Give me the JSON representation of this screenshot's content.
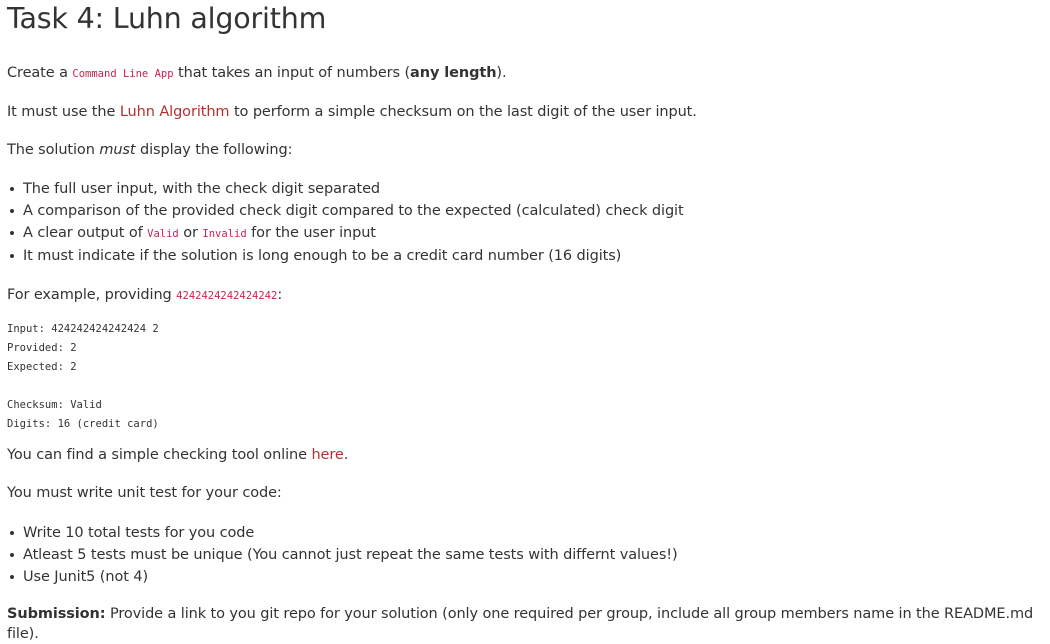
{
  "title": "Task 4: Luhn algorithm",
  "intro": {
    "prefix": "Create a ",
    "code": "Command Line App",
    "middle": " that takes an input of numbers (",
    "bold": "any length",
    "suffix": ")."
  },
  "must_use": {
    "prefix": "It must use the ",
    "link": "Luhn Algorithm",
    "suffix": " to perform a simple checksum on the last digit of the user input."
  },
  "display_intro": {
    "prefix": "The solution ",
    "em": "must",
    "suffix": " display the following:"
  },
  "requirements": {
    "item1": "The full user input, with the check digit separated",
    "item2": "A comparison of the provided check digit compared to the expected (calculated) check digit",
    "item3": {
      "prefix": "A clear output of ",
      "code1": "Valid",
      "middle": " or ",
      "code2": "Invalid",
      "suffix": " for the user input"
    },
    "item4": "It must indicate if the solution is long enough to be a credit card number (16 digits)"
  },
  "example": {
    "prefix": "For example, providing ",
    "code": "4242424242424242",
    "suffix": ":"
  },
  "output_block": {
    "line1": "Input: 424242424242424 2",
    "line2": "Provided: 2",
    "line3": "Expected: 2",
    "line4": "",
    "line5": "Checksum: Valid",
    "line6": "Digits: 16 (credit card)"
  },
  "tool": {
    "prefix": "You can find a simple checking tool online ",
    "link": "here",
    "suffix": "."
  },
  "tests_intro": "You must write unit test for your code:",
  "tests": {
    "item1": "Write 10 total tests for you code",
    "item2": "Atleast 5 tests must be unique (You cannot just repeat the same tests with differnt values!)",
    "item3": "Use Junit5 (not 4)"
  },
  "submission": {
    "label": "Submission:",
    "text": " Provide a link to you git repo for your solution (only one required per group, include all group members name in the README.md file)."
  },
  "colors": {
    "text": "#333333",
    "link": "#b0312f",
    "code": "#c7254e"
  }
}
